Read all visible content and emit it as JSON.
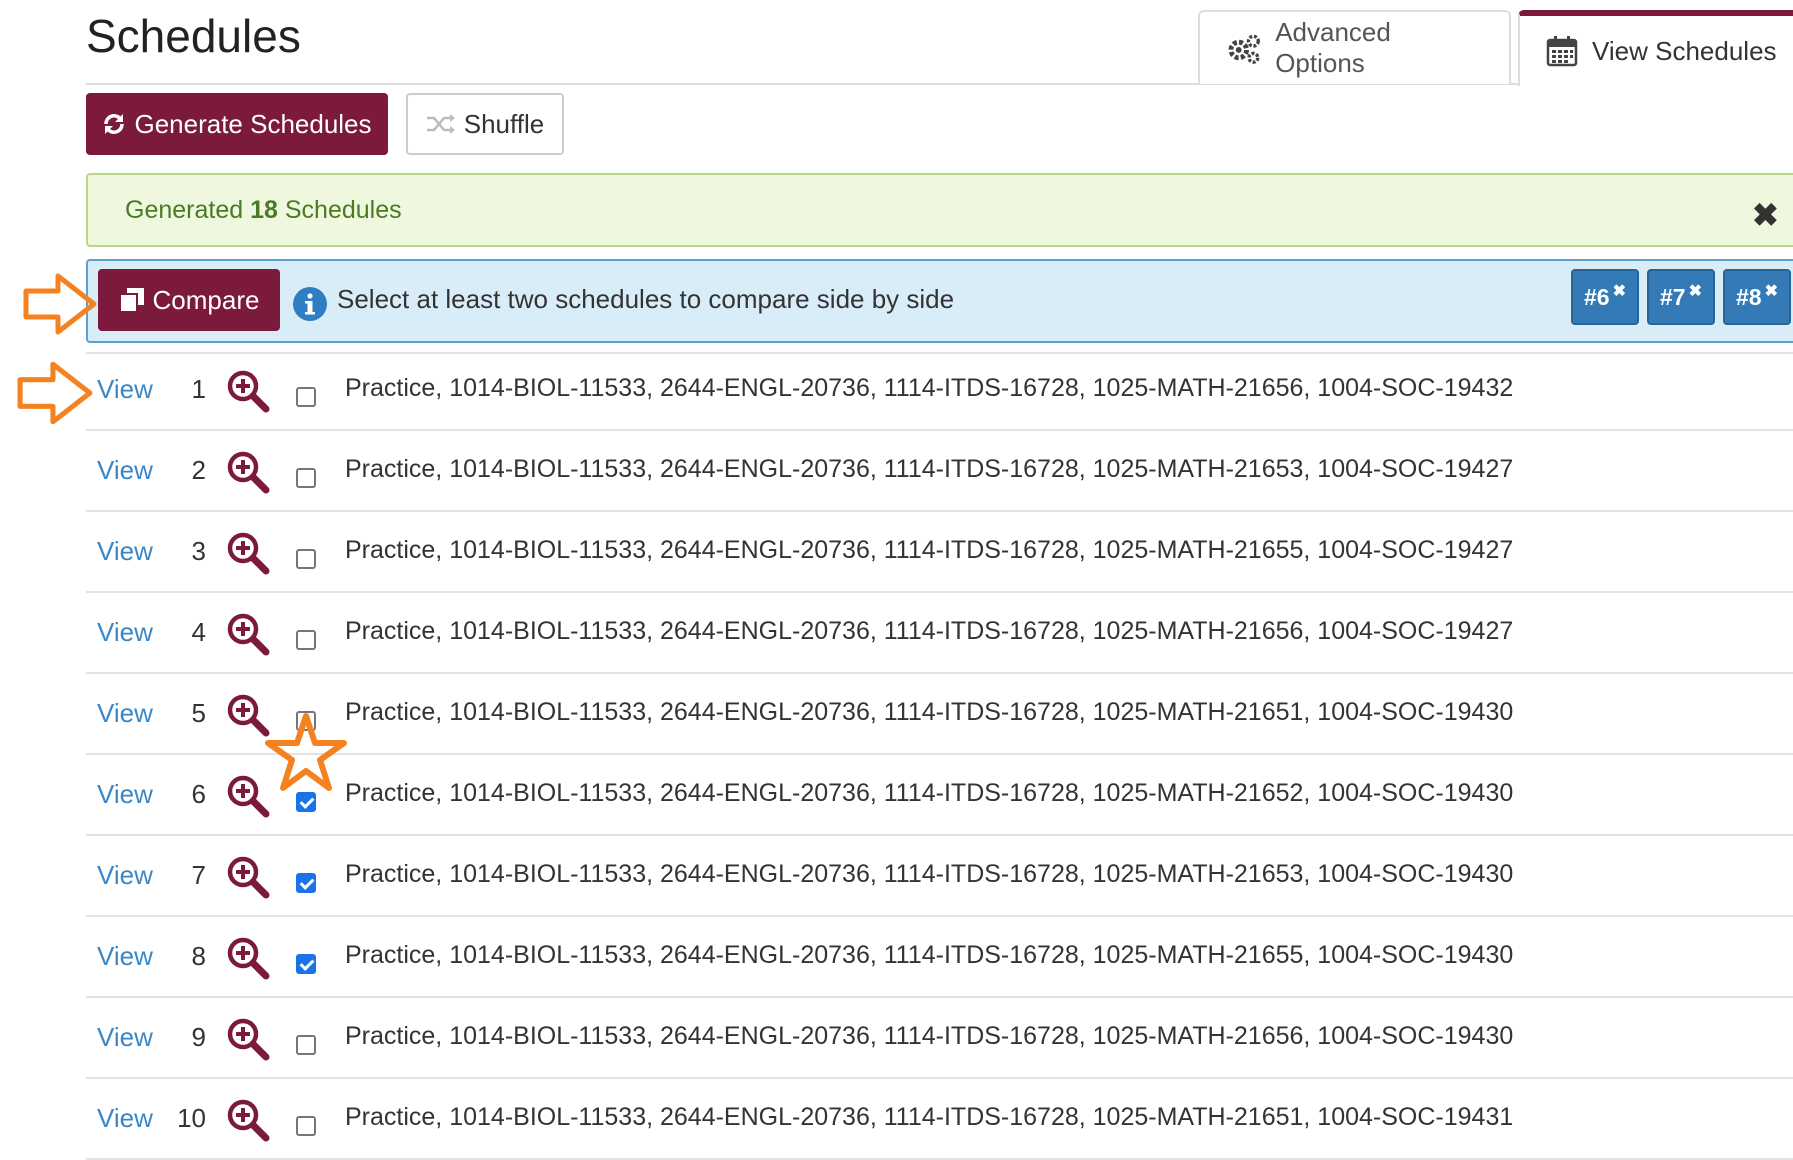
{
  "header": {
    "title": "Schedules"
  },
  "tabs": [
    {
      "label": "Advanced Options",
      "icon": "gears-icon",
      "active": false
    },
    {
      "label": "View Schedules",
      "icon": "calendar-icon",
      "active": true
    }
  ],
  "toolbar": {
    "generate_label": "Generate Schedules",
    "shuffle_label": "Shuffle"
  },
  "alert": {
    "prefix": "Generated",
    "count": "18",
    "suffix": "Schedules",
    "close": "✖"
  },
  "compare": {
    "button_label": "Compare",
    "message": "Select at least two schedules to compare side by side",
    "selected": [
      "#6",
      "#7",
      "#8"
    ],
    "remove_symbol": "✖"
  },
  "schedules": [
    {
      "view": "View",
      "num": "1",
      "checked": false,
      "desc": "Practice, 1014-BIOL-11533, 2644-ENGL-20736, 1114-ITDS-16728, 1025-MATH-21656, 1004-SOC-19432"
    },
    {
      "view": "View",
      "num": "2",
      "checked": false,
      "desc": "Practice, 1014-BIOL-11533, 2644-ENGL-20736, 1114-ITDS-16728, 1025-MATH-21653, 1004-SOC-19427"
    },
    {
      "view": "View",
      "num": "3",
      "checked": false,
      "desc": "Practice, 1014-BIOL-11533, 2644-ENGL-20736, 1114-ITDS-16728, 1025-MATH-21655, 1004-SOC-19427"
    },
    {
      "view": "View",
      "num": "4",
      "checked": false,
      "desc": "Practice, 1014-BIOL-11533, 2644-ENGL-20736, 1114-ITDS-16728, 1025-MATH-21656, 1004-SOC-19427"
    },
    {
      "view": "View",
      "num": "5",
      "checked": false,
      "desc": "Practice, 1014-BIOL-11533, 2644-ENGL-20736, 1114-ITDS-16728, 1025-MATH-21651, 1004-SOC-19430"
    },
    {
      "view": "View",
      "num": "6",
      "checked": true,
      "desc": "Practice, 1014-BIOL-11533, 2644-ENGL-20736, 1114-ITDS-16728, 1025-MATH-21652, 1004-SOC-19430"
    },
    {
      "view": "View",
      "num": "7",
      "checked": true,
      "desc": "Practice, 1014-BIOL-11533, 2644-ENGL-20736, 1114-ITDS-16728, 1025-MATH-21653, 1004-SOC-19430"
    },
    {
      "view": "View",
      "num": "8",
      "checked": true,
      "desc": "Practice, 1014-BIOL-11533, 2644-ENGL-20736, 1114-ITDS-16728, 1025-MATH-21655, 1004-SOC-19430"
    },
    {
      "view": "View",
      "num": "9",
      "checked": false,
      "desc": "Practice, 1014-BIOL-11533, 2644-ENGL-20736, 1114-ITDS-16728, 1025-MATH-21656, 1004-SOC-19430"
    },
    {
      "view": "View",
      "num": "10",
      "checked": false,
      "desc": "Practice, 1014-BIOL-11533, 2644-ENGL-20736, 1114-ITDS-16728, 1025-MATH-21651, 1004-SOC-19431"
    }
  ],
  "colors": {
    "brand": "#7b1a3c",
    "link": "#3a87c8",
    "chip": "#337ab7",
    "annotation": "#f58220"
  }
}
